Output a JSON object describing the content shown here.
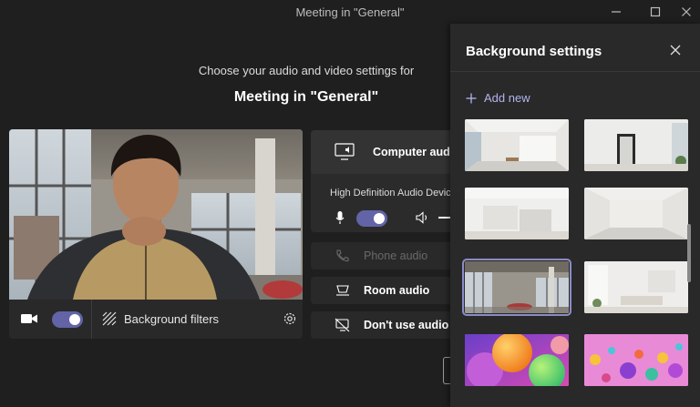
{
  "window": {
    "title": "Meeting in \"General\"",
    "controls": [
      "minimize-icon",
      "maximize-icon",
      "close-icon"
    ]
  },
  "prejoin": {
    "subtitle": "Choose your audio and video settings for",
    "meeting_title": "Meeting in \"General\"",
    "video": {
      "camera_on": true,
      "background_filters_label": "Background filters"
    }
  },
  "audio": {
    "computer_audio_label": "Computer audio",
    "device_label": "High Definition Audio Device",
    "mic_on": true,
    "phone_audio_label": "Phone audio",
    "room_audio_label": "Room audio",
    "no_audio_label": "Don't use audio"
  },
  "background_settings": {
    "title": "Background settings",
    "add_new_label": "Add new",
    "selected_index": 4,
    "thumbnails": [
      "white-loft-room",
      "bright-room-mirror",
      "white-stairs-room",
      "empty-white-room",
      "office-loft-windows",
      "white-living-room",
      "orange-spheres",
      "pink-balloons"
    ]
  },
  "colors": {
    "accent": "#6264a7",
    "accent_light": "#b2b4f0",
    "background": "#1f1f1f",
    "panel": "#292929"
  }
}
